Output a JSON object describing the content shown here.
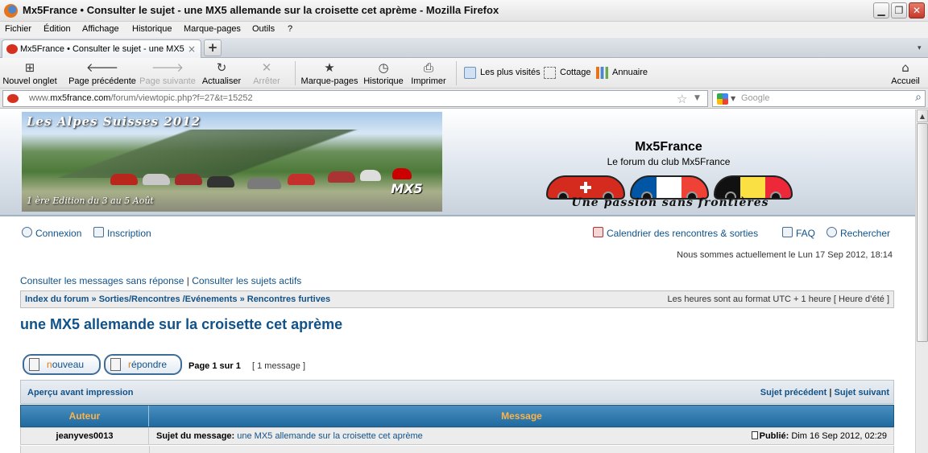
{
  "window": {
    "title": "Mx5France • Consulter le sujet - une MX5 allemande sur la croisette cet aprème - Mozilla Firefox",
    "minimize": "▁",
    "maximize": "❐",
    "close": "✕"
  },
  "menu": [
    "Fichier",
    "Édition",
    "Affichage",
    "Historique",
    "Marque-pages",
    "Outils",
    "?"
  ],
  "tab": {
    "label": "Mx5France • Consulter le sujet - une MX5 all...",
    "close": "×",
    "new_tab": "+",
    "list_arrow": "▾"
  },
  "toolbar": {
    "new_tab": "Nouvel onglet",
    "back": "Page précédente",
    "forward": "Page suivante",
    "reload": "Actualiser",
    "stop": "Arrêter",
    "bookmarks": "Marque-pages",
    "history": "Historique",
    "print": "Imprimer",
    "home": "Accueil"
  },
  "bookmarks": [
    "Les plus visités",
    "Cottage",
    "Annuaire"
  ],
  "address": {
    "url_prefix": "www.",
    "url_domain": "mx5france.com",
    "url_path": "/forum/viewtopic.php?f=27&t=15252",
    "search_placeholder": "Google"
  },
  "banner": {
    "title": "Les Alpes Suisses 2012",
    "subtitle": "1 ère Edition du 3 au 5 Août",
    "logo": "MX5"
  },
  "site": {
    "name": "Mx5France",
    "description": "Le forum du club Mx5France",
    "slogan": "Une passion sans frontières"
  },
  "nav": {
    "login": "Connexion",
    "register": "Inscription",
    "calendar": "Calendrier des rencontres & sorties",
    "faq": "FAQ",
    "search": "Rechercher",
    "datetime": "Nous sommes actuellement le Lun 17 Sep 2012, 18:14"
  },
  "quicklinks": {
    "unanswered": "Consulter les messages sans réponse",
    "separator": "|",
    "active": "Consulter les sujets actifs"
  },
  "breadcrumb": {
    "items": [
      "Index du forum",
      "Sorties/Rencontres /Evénements",
      "Rencontres furtives"
    ],
    "separator": "»",
    "timezone": "Les heures sont au format UTC + 1 heure [ Heure d’été ]"
  },
  "topic": {
    "title": "une MX5 allemande sur la croisette cet aprème",
    "new_button_first": "n",
    "new_button_rest": "ouveau",
    "reply_button_first": "r",
    "reply_button_rest": "épondre",
    "page_info": "Page 1 sur 1",
    "message_count": "[ 1 message ]"
  },
  "printbar": {
    "preview": "Aperçu avant impression",
    "prev_topic": "Sujet précédent",
    "separator": "|",
    "next_topic": "Sujet suivant"
  },
  "table": {
    "col_author": "Auteur",
    "col_message": "Message",
    "rows": [
      {
        "author": "jeanyves0013",
        "subject_label": "Sujet du message:",
        "subject": "une MX5 allemande sur la croisette cet aprème",
        "posted_label": "Publié:",
        "posted": "Dim 16 Sep 2012, 02:29"
      }
    ]
  }
}
